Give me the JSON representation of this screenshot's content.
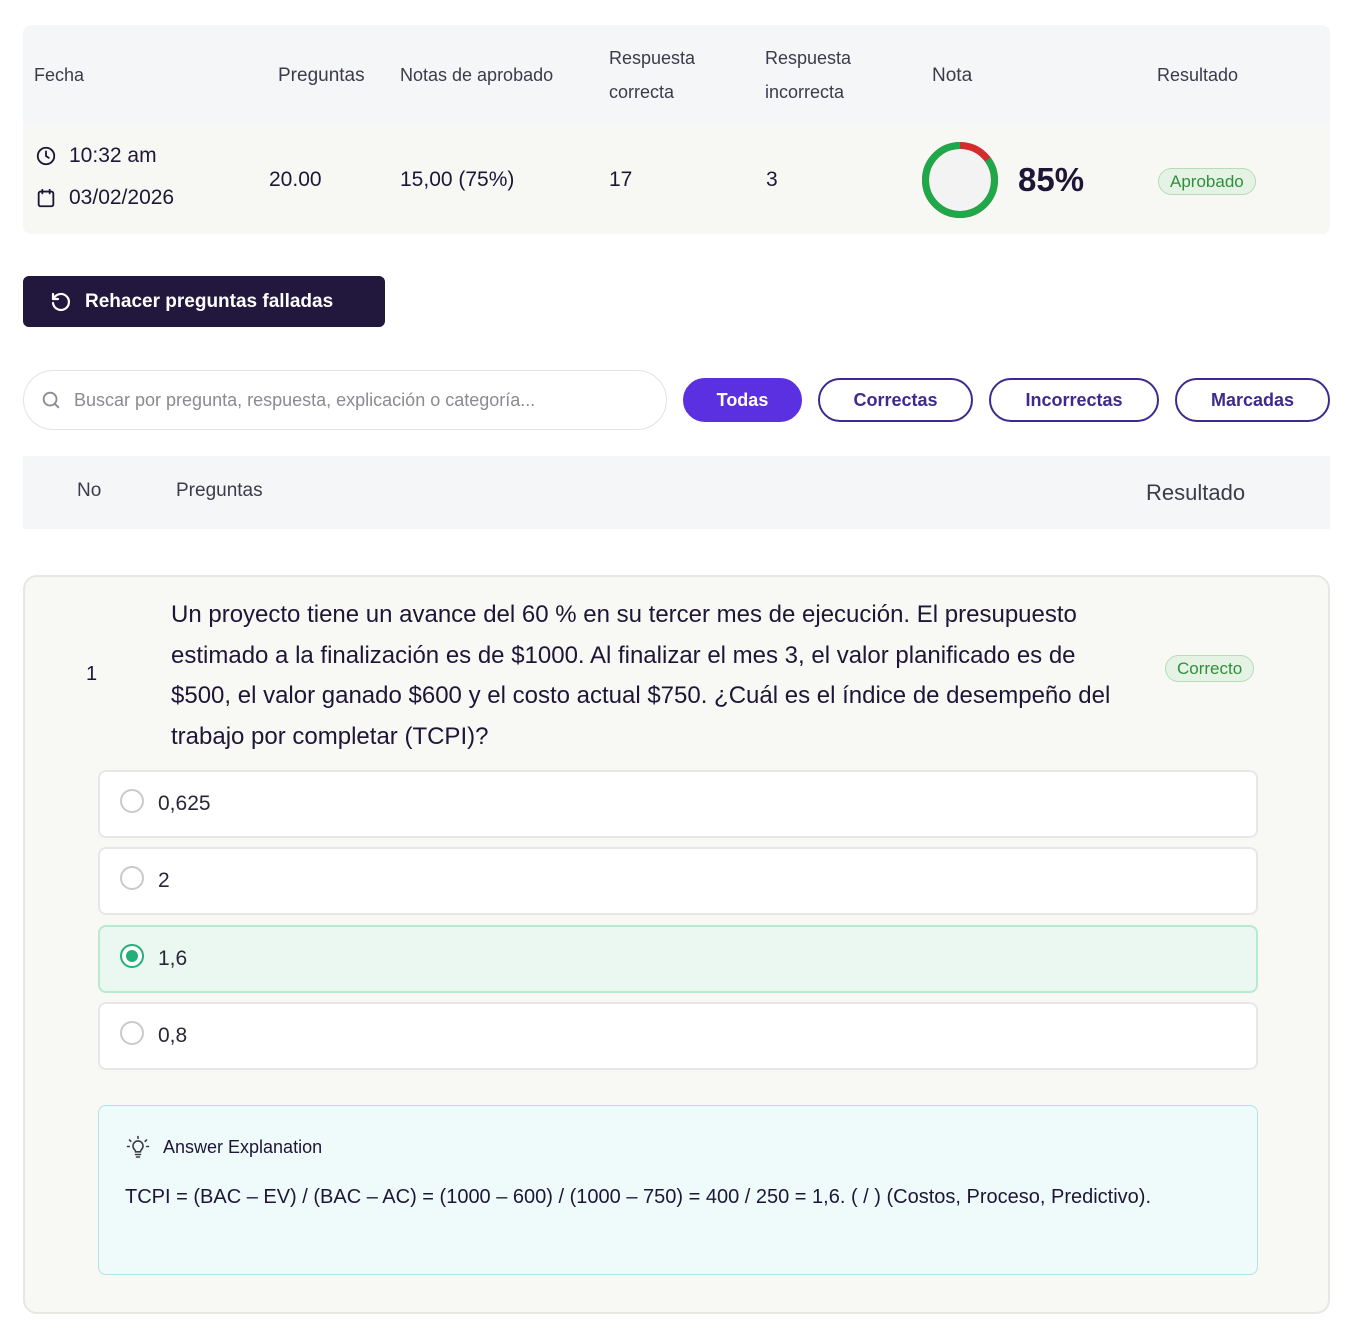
{
  "summary": {
    "headers": {
      "fecha": "Fecha",
      "preguntas": "Preguntas",
      "notas_aprobado": "Notas de aprobado",
      "correcta_1": "Respuesta",
      "correcta_2": "correcta",
      "incorrecta_1": "Respuesta",
      "incorrecta_2": "incorrecta",
      "nota": "Nota",
      "resultado": "Resultado"
    },
    "row": {
      "time": "10:32 am",
      "date": "03/02/2026",
      "preguntas": "20.00",
      "notas_aprobado": "15,00 (75%)",
      "correctas": "17",
      "incorrectas": "3",
      "nota_percent": "85%",
      "nota_fraction": 0.85,
      "resultado": "Aprobado"
    },
    "colors": {
      "correct": "#1ea84a",
      "incorrect": "#d42b2b"
    }
  },
  "actions": {
    "redo_label": "Rehacer preguntas falladas"
  },
  "search": {
    "placeholder": "Buscar por pregunta, respuesta, explicación o categoría..."
  },
  "filters": {
    "todas": "Todas",
    "correctas": "Correctas",
    "incorrectas": "Incorrectas",
    "marcadas": "Marcadas"
  },
  "list_header": {
    "no": "No",
    "preguntas": "Preguntas",
    "resultado": "Resultado"
  },
  "question": {
    "number": "1",
    "text": "Un proyecto tiene un avance del 60 % en su tercer mes de ejecución. El presupuesto estimado a la finalización es de $1000. Al finalizar el mes 3, el valor planificado es de $500, el valor ganado $600 y el costo actual $750. ¿Cuál es el índice de desempeño del trabajo por completar (TCPI)?",
    "result": "Correcto",
    "options": [
      "0,625",
      "2",
      "1,6",
      "0,8"
    ],
    "selected_index": 2,
    "explanation_title": "Answer Explanation",
    "explanation": "TCPI = (BAC – EV) / (BAC – AC) = (1000 – 600) / (1000 – 750) = 400 / 250 = 1,6. ( / ) (Costos, Proceso, Predictivo)."
  }
}
